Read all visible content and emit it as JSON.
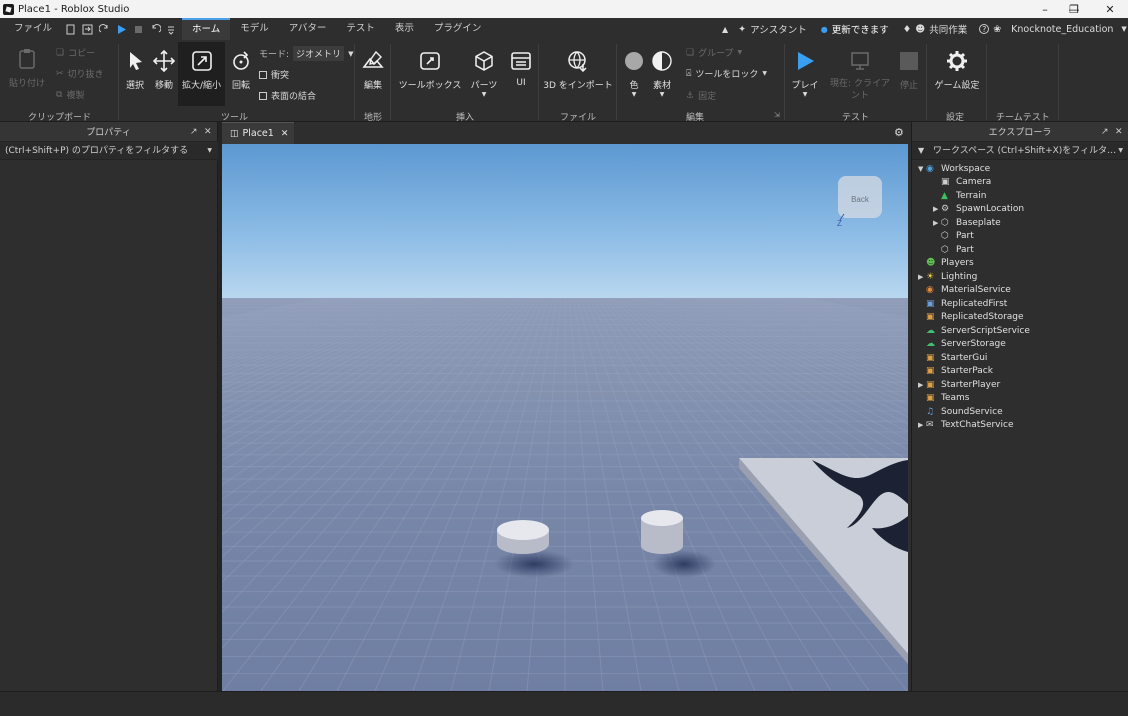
{
  "window": {
    "title": "Place1 - Roblox Studio",
    "controls": [
      "minimize",
      "restore",
      "close"
    ]
  },
  "menubar": {
    "file": "ファイル",
    "tabs": [
      "ホーム",
      "モデル",
      "アバター",
      "テスト",
      "表示",
      "プラグイン"
    ],
    "active_tab": "ホーム",
    "assistant": "アシスタント",
    "update": "更新できます",
    "collab": "共同作業",
    "user": "Knocknote_Education"
  },
  "ribbon": {
    "clipboard": {
      "paste": "貼り付け",
      "copy": "コピー",
      "cut": "切り抜き",
      "duplicate": "複製",
      "label": "クリップボード"
    },
    "tools": {
      "select": "選択",
      "move": "移動",
      "scale": "拡大/縮小",
      "rotate": "回転",
      "mode_label": "モード:",
      "mode_value": "ジオメトリ",
      "collisions": "衝突",
      "join_surfaces": "表面の結合",
      "label": "ツール"
    },
    "terrain": {
      "edit": "編集",
      "label": "地形"
    },
    "insert": {
      "toolbox": "ツールボックス",
      "part": "パーツ",
      "ui": "UI",
      "label": "挿入"
    },
    "file": {
      "import3d": "3D をインポート",
      "label": "ファイル"
    },
    "edit": {
      "color": "色",
      "material": "素材",
      "group": "グループ",
      "lock": "ツールをロック",
      "anchor": "固定",
      "label": "編集"
    },
    "test": {
      "play": "プレイ",
      "current_client": "現在: クライアント",
      "stop": "停止",
      "label": "テスト"
    },
    "settings": {
      "game_settings": "ゲーム設定",
      "label": "設定"
    },
    "team_test": {
      "label": "チームテスト"
    }
  },
  "properties": {
    "title": "プロパティ",
    "filter_placeholder": "(Ctrl+Shift+P) のプロパティをフィルタする"
  },
  "document_tab": {
    "label": "Place1"
  },
  "viewcube": {
    "label": "Back",
    "axis": "Z"
  },
  "explorer": {
    "title": "エクスプローラ",
    "filter_placeholder": "ワークスペース (Ctrl+Shift+X)をフィルタ…",
    "items": [
      {
        "label": "Workspace",
        "depth": 0,
        "expand": "open",
        "icon": "workspace-icon",
        "color": "#4aa3df"
      },
      {
        "label": "Camera",
        "depth": 1,
        "expand": "none",
        "icon": "camera-icon",
        "color": "#cfcfcf"
      },
      {
        "label": "Terrain",
        "depth": 1,
        "expand": "none",
        "icon": "terrain-icon",
        "color": "#3fbf5f"
      },
      {
        "label": "SpawnLocation",
        "depth": 1,
        "expand": "closed",
        "icon": "spawn-icon",
        "color": "#cfcfcf"
      },
      {
        "label": "Baseplate",
        "depth": 1,
        "expand": "closed",
        "icon": "part-icon",
        "color": "#cfcfcf"
      },
      {
        "label": "Part",
        "depth": 1,
        "expand": "none",
        "icon": "part-icon",
        "color": "#cfcfcf"
      },
      {
        "label": "Part",
        "depth": 1,
        "expand": "none",
        "icon": "part-icon",
        "color": "#cfcfcf"
      },
      {
        "label": "Players",
        "depth": 0,
        "expand": "none",
        "icon": "players-icon",
        "color": "#5fbf4f"
      },
      {
        "label": "Lighting",
        "depth": 0,
        "expand": "closed",
        "icon": "lighting-icon",
        "color": "#f0d04a"
      },
      {
        "label": "MaterialService",
        "depth": 0,
        "expand": "none",
        "icon": "material-service-icon",
        "color": "#e08a3a"
      },
      {
        "label": "ReplicatedFirst",
        "depth": 0,
        "expand": "none",
        "icon": "replicated-first-icon",
        "color": "#6a9fe0"
      },
      {
        "label": "ReplicatedStorage",
        "depth": 0,
        "expand": "none",
        "icon": "replicated-storage-icon",
        "color": "#e0a040"
      },
      {
        "label": "ServerScriptService",
        "depth": 0,
        "expand": "none",
        "icon": "server-script-icon",
        "color": "#3fbf6f"
      },
      {
        "label": "ServerStorage",
        "depth": 0,
        "expand": "none",
        "icon": "server-storage-icon",
        "color": "#3fbf6f"
      },
      {
        "label": "StarterGui",
        "depth": 0,
        "expand": "none",
        "icon": "starter-gui-icon",
        "color": "#e0a040"
      },
      {
        "label": "StarterPack",
        "depth": 0,
        "expand": "none",
        "icon": "starter-pack-icon",
        "color": "#e0a040"
      },
      {
        "label": "StarterPlayer",
        "depth": 0,
        "expand": "closed",
        "icon": "starter-player-icon",
        "color": "#e0a040"
      },
      {
        "label": "Teams",
        "depth": 0,
        "expand": "none",
        "icon": "teams-icon",
        "color": "#e0a040"
      },
      {
        "label": "SoundService",
        "depth": 0,
        "expand": "none",
        "icon": "sound-icon",
        "color": "#6a9fe0"
      },
      {
        "label": "TextChatService",
        "depth": 0,
        "expand": "closed",
        "icon": "chat-icon",
        "color": "#cfcfcf"
      }
    ]
  }
}
